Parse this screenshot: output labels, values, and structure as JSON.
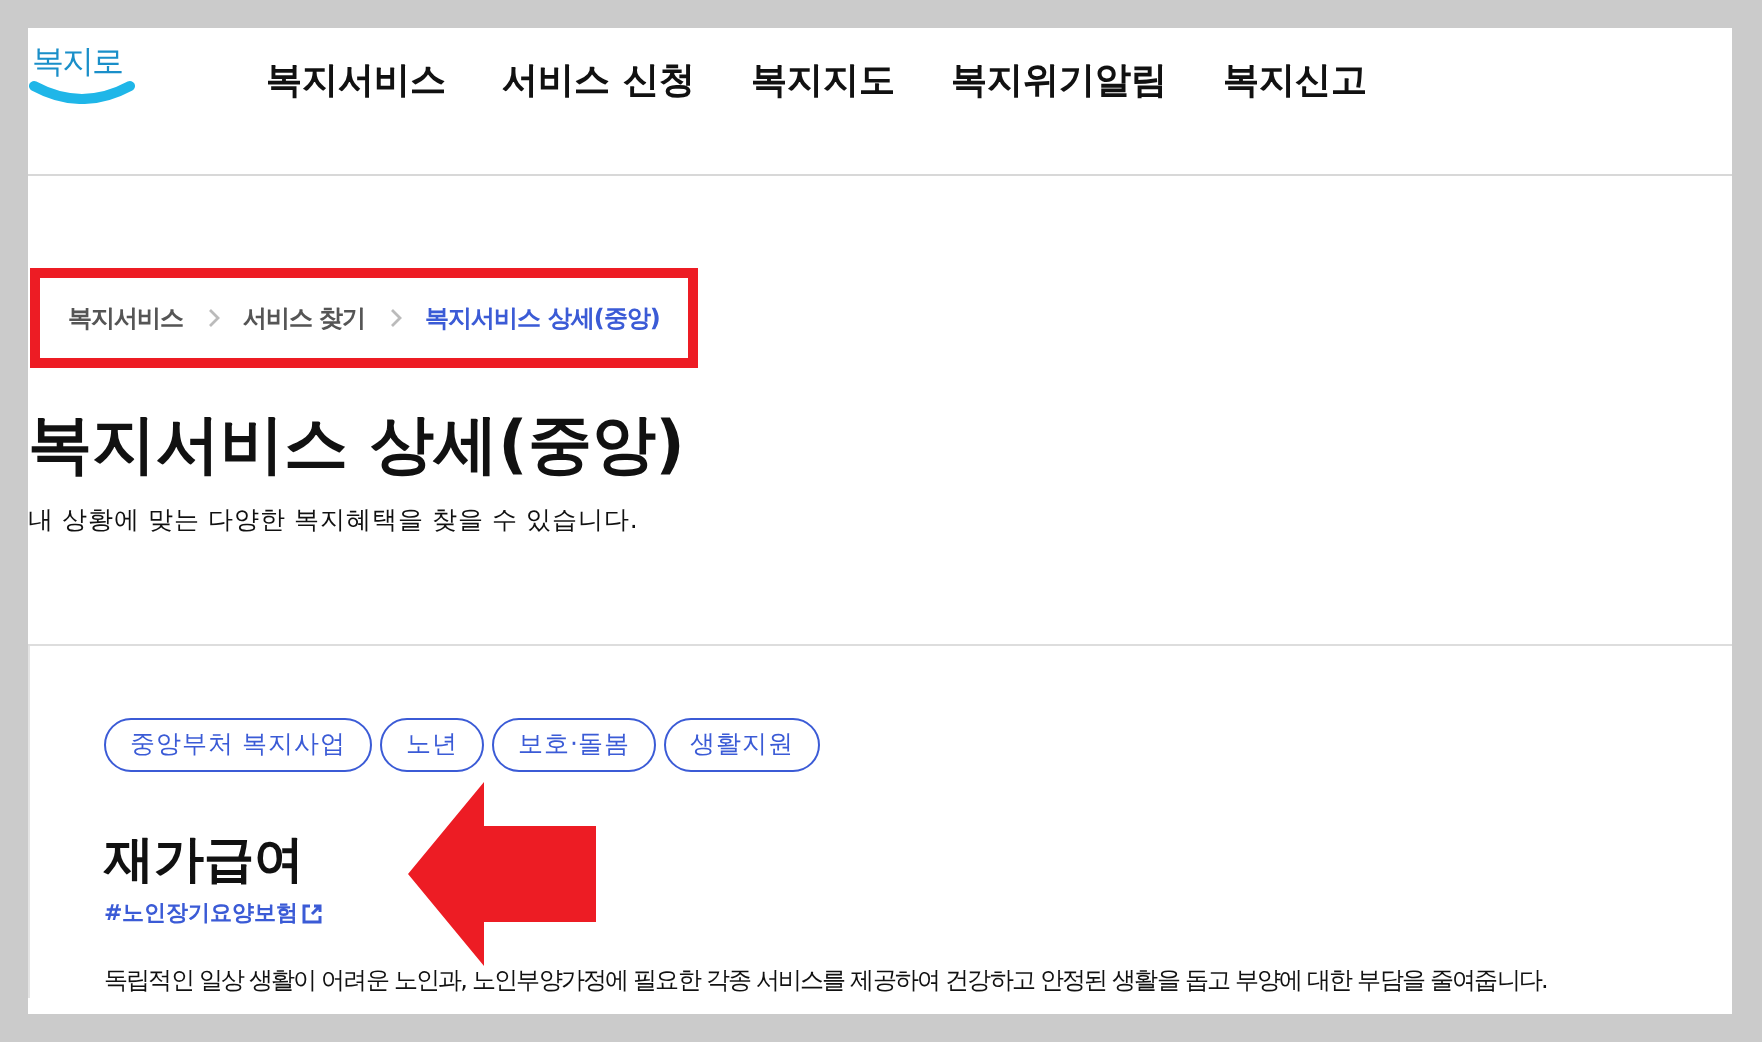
{
  "header": {
    "logo": "복지로",
    "nav": [
      "복지서비스",
      "서비스 신청",
      "복지지도",
      "복지위기알림",
      "복지신고"
    ]
  },
  "breadcrumb": [
    {
      "label": "복지서비스",
      "selected": false
    },
    {
      "label": "서비스 찾기",
      "selected": false
    },
    {
      "label": "복지서비스 상세(중앙)",
      "selected": true
    }
  ],
  "page_title": "복지서비스 상세(중앙)",
  "page_subtitle": "내 상황에 맞는 다양한 복지혜택을 찾을 수 있습니다.",
  "service": {
    "tags": [
      "중앙부처 복지사업",
      "노년",
      "보호·돌봄",
      "생활지원"
    ],
    "title": "재가급여",
    "link": "#노인장기요양보험",
    "description": "독립적인 일상 생활이 어려운 노인과, 노인부양가정에 필요한 각종 서비스를 제공하여 건강하고 안정된 생활을 돕고 부양에 대한 부담을 줄여줍니다."
  }
}
